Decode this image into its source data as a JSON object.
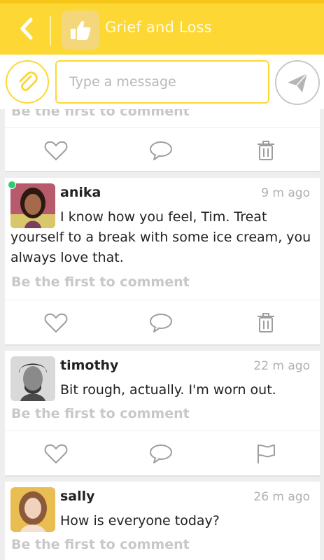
{
  "header": {
    "back_icon": "chevron-left-icon",
    "group_icon": "thumbs-up-icon",
    "title": "Grief and Loss"
  },
  "composer": {
    "attach_icon": "paperclip-icon",
    "placeholder": "Type a message",
    "send_icon": "paper-plane-icon"
  },
  "posts": [
    {
      "comment_prompt": "Be the first to comment",
      "actions": [
        "heart-icon",
        "comment-icon",
        "trash-icon"
      ]
    },
    {
      "username": "anika",
      "time": "9 m ago",
      "online": true,
      "avatar_colors": [
        "#c56a4e",
        "#3b2418"
      ],
      "text": "I know how you feel, Tim. Treat yourself to a break with some ice cream, you always love that.",
      "comment_prompt": "Be the first to comment",
      "actions": [
        "heart-icon",
        "comment-icon",
        "trash-icon"
      ]
    },
    {
      "username": "timothy",
      "time": "22 m ago",
      "online": false,
      "avatar_colors": [
        "#cfcfcf",
        "#2a2a2a"
      ],
      "text": "Bit rough, actually. I'm worn out.",
      "comment_prompt": "Be the first to comment",
      "actions": [
        "heart-icon",
        "comment-icon",
        "flag-icon"
      ]
    },
    {
      "username": "sally",
      "time": "26 m ago",
      "online": false,
      "avatar_colors": [
        "#e6b84a",
        "#8a5a3a"
      ],
      "text": "How is everyone today?",
      "comment_prompt": "Be the first to comment"
    }
  ],
  "colors": {
    "accent": "#fdd835",
    "online": "#2ecc71",
    "muted": "#c8c8c8"
  }
}
